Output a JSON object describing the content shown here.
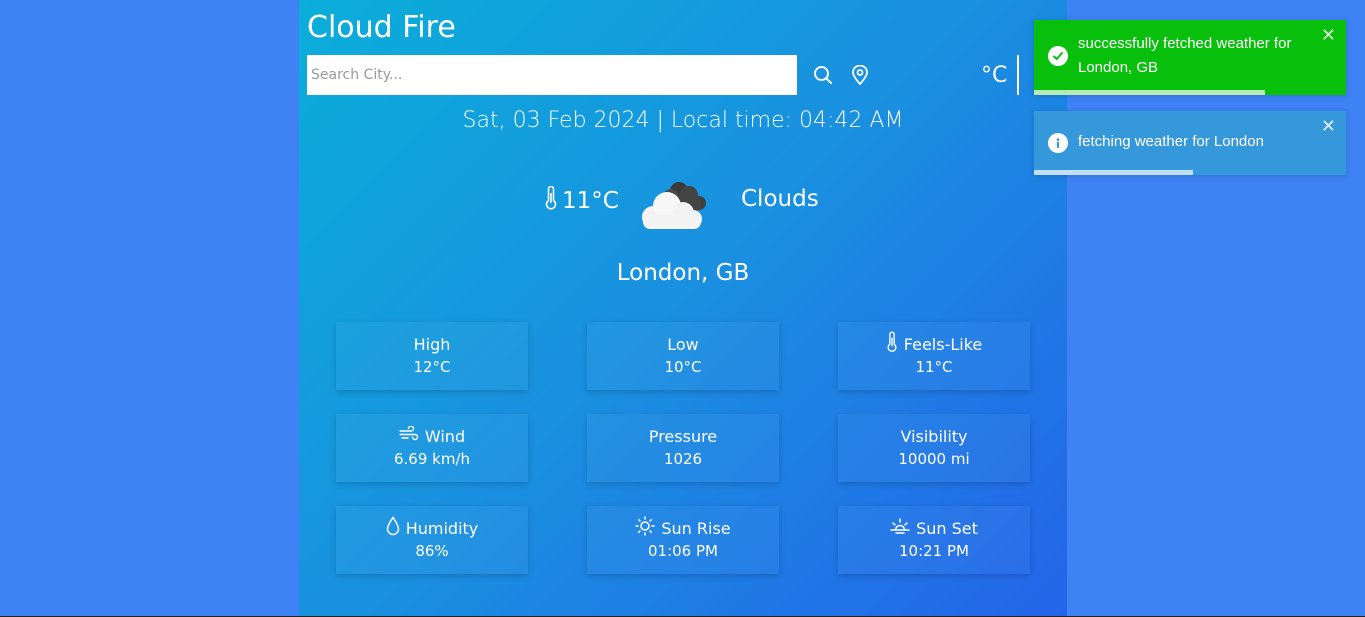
{
  "app": {
    "title": "Cloud Fire",
    "search": {
      "placeholder": "Search City...",
      "value": ""
    },
    "icons": {
      "search": "search-icon",
      "location": "location-pin-icon"
    },
    "unit_label": "°C"
  },
  "datetime": "Sat, 03 Feb 2024 | Local time: 04:42 AM",
  "current": {
    "temperature": "11°C",
    "condition": "Clouds",
    "condition_icon": "clouds-icon",
    "location": "London, GB"
  },
  "details": [
    {
      "label": "High",
      "value": "12°C",
      "icon": ""
    },
    {
      "label": "Low",
      "value": "10°C",
      "icon": ""
    },
    {
      "label": "Feels-Like",
      "value": "11°C",
      "icon": "thermometer-icon"
    },
    {
      "label": "Wind",
      "value": "6.69 km/h",
      "icon": "wind-icon"
    },
    {
      "label": "Pressure",
      "value": "1026",
      "icon": ""
    },
    {
      "label": "Visibility",
      "value": "10000 mi",
      "icon": ""
    },
    {
      "label": "Humidity",
      "value": "86%",
      "icon": "droplet-icon"
    },
    {
      "label": "Sun Rise",
      "value": "01:06 PM",
      "icon": "sun-icon"
    },
    {
      "label": "Sun Set",
      "value": "10:21 PM",
      "icon": "sunset-icon"
    }
  ],
  "toasts": [
    {
      "type": "success",
      "message": "successfully fetched weather for London, GB",
      "icon": "check-circle-icon",
      "progress": 0.74
    },
    {
      "type": "info",
      "message": "fetching weather for London",
      "icon": "info-icon",
      "progress": 0.51
    }
  ],
  "colors": {
    "page_background": "#3e82f5",
    "panel_gradient_start": "#0aaed9",
    "panel_gradient_end": "#2464ea",
    "toast_success": "#08bf0b",
    "toast_info": "#3498db"
  }
}
